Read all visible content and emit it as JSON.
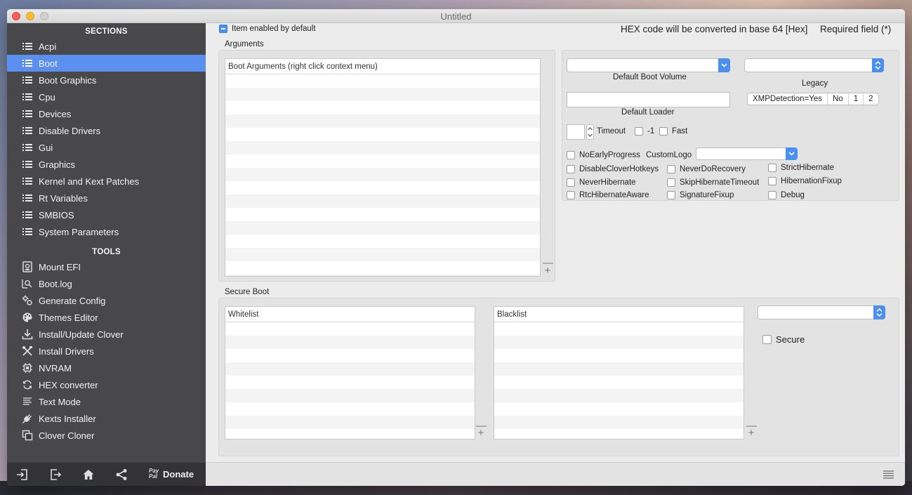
{
  "window": {
    "title": "Untitled"
  },
  "sidebar": {
    "sections_header": "SECTIONS",
    "tools_header": "TOOLS",
    "sections": [
      {
        "label": "Acpi"
      },
      {
        "label": "Boot"
      },
      {
        "label": "Boot Graphics"
      },
      {
        "label": "Cpu"
      },
      {
        "label": "Devices"
      },
      {
        "label": "Disable Drivers"
      },
      {
        "label": "Gui"
      },
      {
        "label": "Graphics"
      },
      {
        "label": "Kernel and Kext Patches"
      },
      {
        "label": "Rt Variables"
      },
      {
        "label": "SMBIOS"
      },
      {
        "label": "System Parameters"
      }
    ],
    "active_section": "Boot",
    "tools": [
      {
        "label": "Mount EFI",
        "icon": "disk-icon"
      },
      {
        "label": "Boot.log",
        "icon": "log-search-icon"
      },
      {
        "label": "Generate Config",
        "icon": "gears-icon"
      },
      {
        "label": "Themes Editor",
        "icon": "palette-icon"
      },
      {
        "label": "Install/Update Clover",
        "icon": "download-icon"
      },
      {
        "label": "Install Drivers",
        "icon": "tools-icon"
      },
      {
        "label": "NVRAM",
        "icon": "chip-icon"
      },
      {
        "label": "HEX converter",
        "icon": "convert-icon"
      },
      {
        "label": "Text Mode",
        "icon": "text-lines-icon"
      },
      {
        "label": "Kexts Installer",
        "icon": "plug-icon"
      },
      {
        "label": "Clover Cloner",
        "icon": "clone-icon"
      }
    ],
    "bottom": {
      "paypal_line1": "Pay",
      "paypal_line2": "Pal",
      "donate_label": "Donate"
    }
  },
  "main": {
    "item_enabled_label": "Item enabled by default",
    "hex_note": "HEX code will be converted in base 64 [Hex]",
    "required_note": "Required field (*)",
    "arguments": {
      "title": "Arguments",
      "table_header": "Boot Arguments (right click context menu)",
      "default_boot_volume_label": "Default Boot Volume",
      "legacy_label": "Legacy",
      "default_loader_label": "Default Loader",
      "xmp_segments": [
        "XMPDetection=Yes",
        "No",
        "1",
        "2"
      ],
      "timeout_label": "Timeout",
      "timeout_value": "",
      "minus_one_label": "-1",
      "fast_label": "Fast",
      "custom_logo_label": "CustomLogo",
      "checkboxes_col1": [
        "NoEarlyProgress",
        "DisableCloverHotkeys",
        "NeverHibernate",
        "RtcHibernateAware"
      ],
      "checkboxes_col2": [
        "NeverDoRecovery",
        "SkipHibernateTimeout",
        "SignatureFixup"
      ],
      "checkboxes_col3": [
        "StrictHibernate",
        "HibernationFixup",
        "Debug"
      ]
    },
    "secure_boot": {
      "title": "Secure Boot",
      "whitelist_header": "Whitelist",
      "blacklist_header": "Blacklist",
      "secure_label": "Secure"
    }
  },
  "colors": {
    "accent": "#5b8ff0",
    "sidebar_bg": "#3a3a3c"
  }
}
